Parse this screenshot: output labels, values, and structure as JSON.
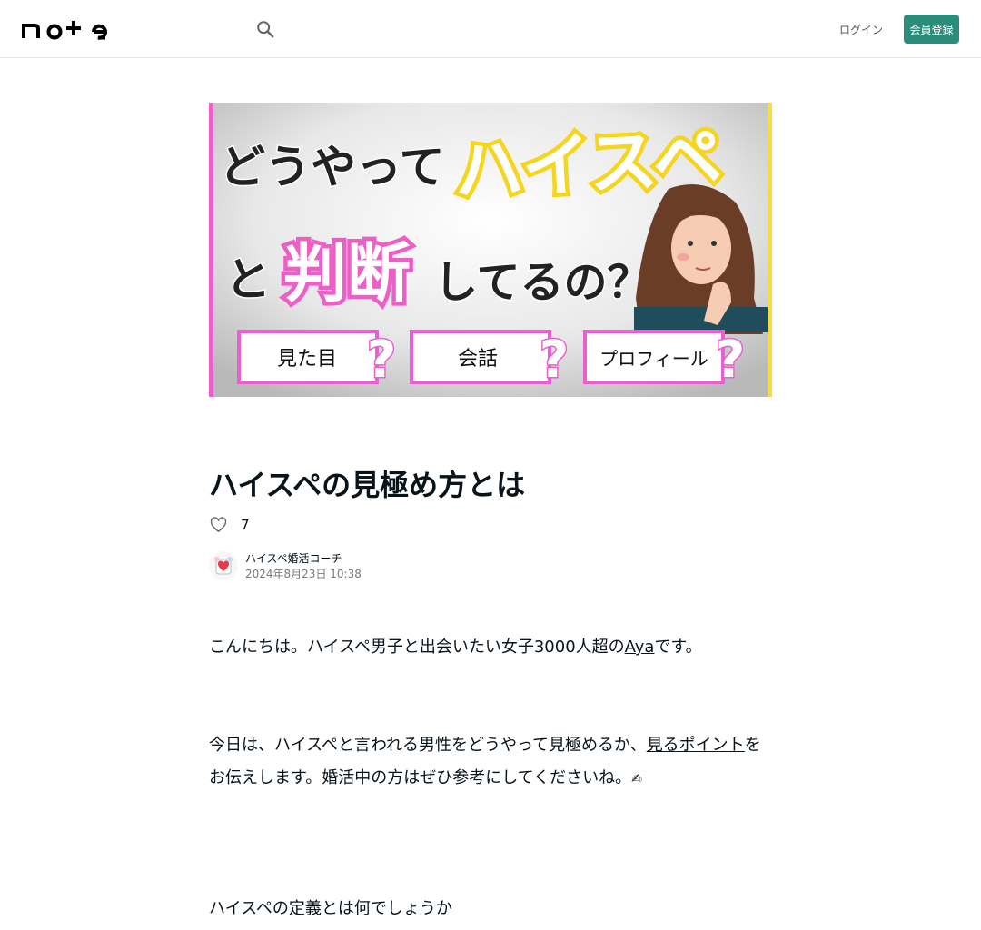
{
  "header": {
    "logo_text": "note",
    "search_icon": "search-icon",
    "login_label": "ログイン",
    "signup_label": "会員登録",
    "accent_color": "#2c8c7c"
  },
  "hero_image": {
    "headline_line1_a": "どうやって",
    "headline_line1_b": "ハイスペ",
    "headline_line2_a": "と",
    "headline_line2_b": "判断",
    "headline_line2_c": "してるの？",
    "tags": [
      "見た目",
      "会話",
      "プロフィール"
    ],
    "tag_mark": "?"
  },
  "article": {
    "title": "ハイスペの見極め方とは",
    "like_icon": "heart-icon",
    "like_count": "7",
    "author_name": "ハイスペ婚活コーチ",
    "date": "2024年8月23日 10:38",
    "p1_before": "こんにちは。ハイスペ男子と出会いたい女子3000人超の",
    "p1_link": "Aya",
    "p1_after": "です。",
    "p2_before": "今日は、ハイスペと言われる男性をどうやって見極めるか、",
    "p2_link": "見るポイント",
    "p2_after": "をお伝えします。婚活中の方はぜひ参考にしてくださいね。",
    "p2_emoji": "✍",
    "p3": "ハイスペの定義とは何でしょうか"
  }
}
